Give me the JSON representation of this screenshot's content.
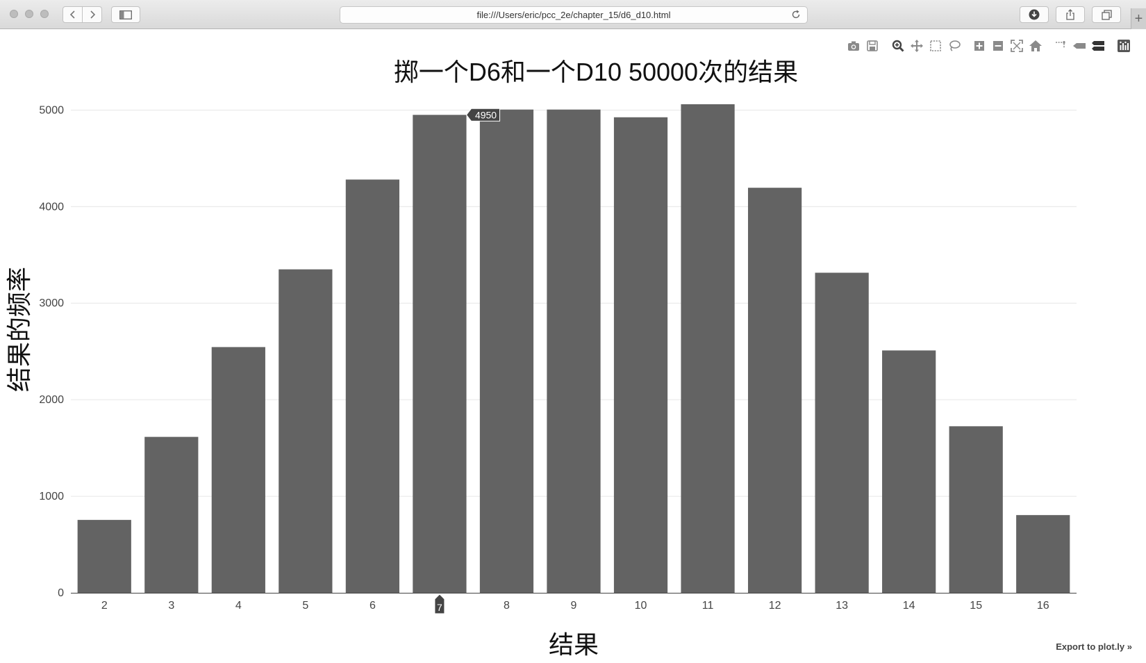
{
  "browser": {
    "url": "file:///Users/eric/pcc_2e/chapter_15/d6_d10.html"
  },
  "modebar": {
    "icons": [
      "camera-icon",
      "save-icon",
      "zoom-icon",
      "pan-icon",
      "box-select-icon",
      "lasso-select-icon",
      "zoom-in-icon",
      "zoom-out-icon",
      "autoscale-icon",
      "reset-axes-icon",
      "spike-lines-icon",
      "hover-closest-icon",
      "hover-compare-icon",
      "plotly-logo-icon"
    ]
  },
  "export_link": "Export to plot.ly »",
  "chart_data": {
    "type": "bar",
    "title": "掷一个D6和一个D10 50000次的结果",
    "xlabel": "结果",
    "ylabel": "结果的频率",
    "categories": [
      "2",
      "3",
      "4",
      "5",
      "6",
      "7",
      "8",
      "9",
      "10",
      "11",
      "12",
      "13",
      "14",
      "15",
      "16"
    ],
    "values": [
      755,
      1615,
      2545,
      3350,
      4280,
      4950,
      5005,
      5005,
      4925,
      5060,
      4195,
      3315,
      2510,
      1725,
      805
    ],
    "ylim": [
      0,
      5060
    ],
    "yticks": [
      0,
      1000,
      2000,
      3000,
      4000,
      5000
    ],
    "grid": true,
    "bar_color": "#636363",
    "hover": {
      "value_label": "4950",
      "category_label": "7"
    }
  }
}
